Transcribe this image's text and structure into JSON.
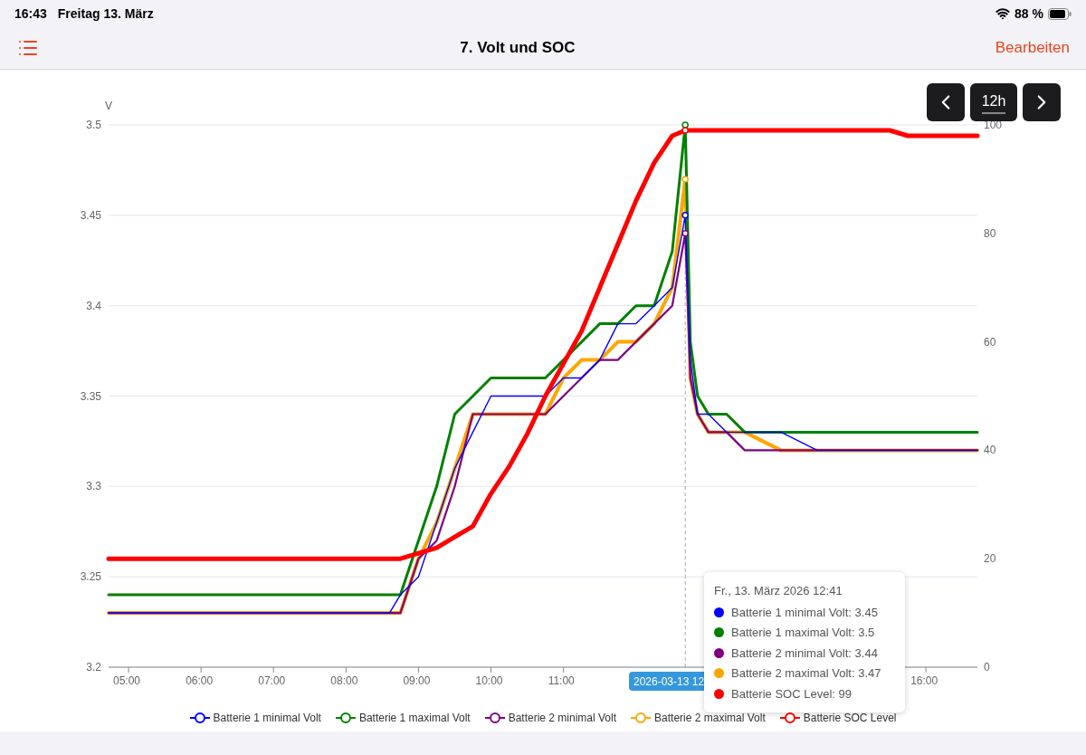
{
  "status_bar": {
    "time": "16:43",
    "date": "Freitag 13. März",
    "battery": "88 %"
  },
  "nav_bar": {
    "title": "7. Volt und SOC",
    "edit_button": "Bearbeiten"
  },
  "range_controls": {
    "range": "12h"
  },
  "chart": {
    "chart_data": {
      "type": "line",
      "ylabel": "V",
      "xlim": [
        4.725,
        16.71
      ],
      "ylim": [
        3.2,
        3.5
      ],
      "y2lim": [
        0,
        100
      ],
      "x": [
        4.725,
        8.6,
        8.75,
        9.0,
        9.25,
        9.5,
        9.75,
        10.0,
        10.25,
        10.5,
        10.75,
        11.0,
        11.25,
        11.5,
        11.75,
        12.0,
        12.25,
        12.5,
        12.68,
        12.75,
        12.85,
        13.0,
        13.25,
        13.5,
        14.0,
        14.5,
        15.0,
        15.5,
        15.75,
        16.0,
        16.71
      ],
      "xticks": [
        {
          "value": 5,
          "label": "05:00"
        },
        {
          "value": 6,
          "label": "06:00"
        },
        {
          "value": 7,
          "label": "07:00"
        },
        {
          "value": 8,
          "label": "08:00"
        },
        {
          "value": 9,
          "label": "09:00"
        },
        {
          "value": 10,
          "label": "10:00"
        },
        {
          "value": 11,
          "label": "11:00"
        },
        {
          "value": 16,
          "label": "16:00"
        }
      ],
      "yticks": [
        {
          "value": 3.2,
          "label": "3.2"
        },
        {
          "value": 3.25,
          "label": "3.25"
        },
        {
          "value": 3.3,
          "label": "3.3"
        },
        {
          "value": 3.35,
          "label": "3.35"
        },
        {
          "value": 3.4,
          "label": "3.4"
        },
        {
          "value": 3.45,
          "label": "3.45"
        },
        {
          "value": 3.5,
          "label": "3.5"
        }
      ],
      "y2ticks": [
        0,
        20,
        40,
        60,
        80,
        100
      ],
      "series": [
        {
          "name": "Batterie 1 minimal Volt",
          "color": "#0000ff",
          "values": [
            3.23,
            3.23,
            3.24,
            3.25,
            3.28,
            3.31,
            3.33,
            3.35,
            3.35,
            3.35,
            3.35,
            3.36,
            3.36,
            3.37,
            3.39,
            3.39,
            3.4,
            3.41,
            3.45,
            3.37,
            3.34,
            3.34,
            3.33,
            3.33,
            3.33,
            3.32,
            3.32,
            3.32,
            3.32,
            3.32,
            3.32
          ]
        },
        {
          "name": "Batterie 1 maximal Volt",
          "color": "#008000",
          "values": [
            3.24,
            3.24,
            3.24,
            3.27,
            3.3,
            3.34,
            3.35,
            3.36,
            3.36,
            3.36,
            3.36,
            3.37,
            3.38,
            3.39,
            3.39,
            3.4,
            3.4,
            3.43,
            3.5,
            3.38,
            3.35,
            3.34,
            3.34,
            3.33,
            3.33,
            3.33,
            3.33,
            3.33,
            3.33,
            3.33,
            3.33
          ]
        },
        {
          "name": "Batterie 2 minimal Volt",
          "color": "#800080",
          "values": [
            3.23,
            3.23,
            3.23,
            3.26,
            3.27,
            3.3,
            3.34,
            3.34,
            3.34,
            3.34,
            3.34,
            3.35,
            3.36,
            3.37,
            3.37,
            3.38,
            3.39,
            3.4,
            3.44,
            3.36,
            3.34,
            3.33,
            3.33,
            3.32,
            3.32,
            3.32,
            3.32,
            3.32,
            3.32,
            3.32,
            3.32
          ]
        },
        {
          "name": "Batterie 2 maximal Volt",
          "color": "#ffa500",
          "values": [
            3.23,
            3.23,
            3.23,
            3.26,
            3.28,
            3.31,
            3.34,
            3.34,
            3.34,
            3.34,
            3.34,
            3.36,
            3.37,
            3.37,
            3.38,
            3.38,
            3.39,
            3.41,
            3.47,
            3.36,
            3.34,
            3.33,
            3.33,
            3.33,
            3.32,
            3.32,
            3.32,
            3.32,
            3.32,
            3.32,
            3.32
          ]
        },
        {
          "name": "Batterie SOC Level",
          "color": "#ff0000",
          "axis": "y2",
          "values": [
            20,
            20,
            20,
            21,
            22,
            24,
            26,
            32,
            37,
            43,
            50,
            56,
            62,
            70,
            78,
            86,
            93,
            98,
            99,
            99,
            99,
            99,
            99,
            99,
            99,
            99,
            99,
            99,
            98,
            98,
            98
          ]
        }
      ],
      "ref_lines": [
        {
          "axis": "x",
          "value": 12.68
        }
      ],
      "grid": true
    },
    "crosshair_label": "2026-03-13 12",
    "tooltip": {
      "title": "Fr., 13. März 2026 12:41",
      "items": [
        {
          "text": "Batterie 1 minimal Volt: 3.45",
          "color": "#0000ff"
        },
        {
          "text": "Batterie 1 maximal Volt: 3.5",
          "color": "#008000"
        },
        {
          "text": "Batterie 2 minimal Volt: 3.44",
          "color": "#800080"
        },
        {
          "text": "Batterie 2 maximal Volt: 3.47",
          "color": "#ffa500"
        },
        {
          "text": "Batterie SOC Level: 99",
          "color": "#ff0000"
        }
      ]
    }
  }
}
